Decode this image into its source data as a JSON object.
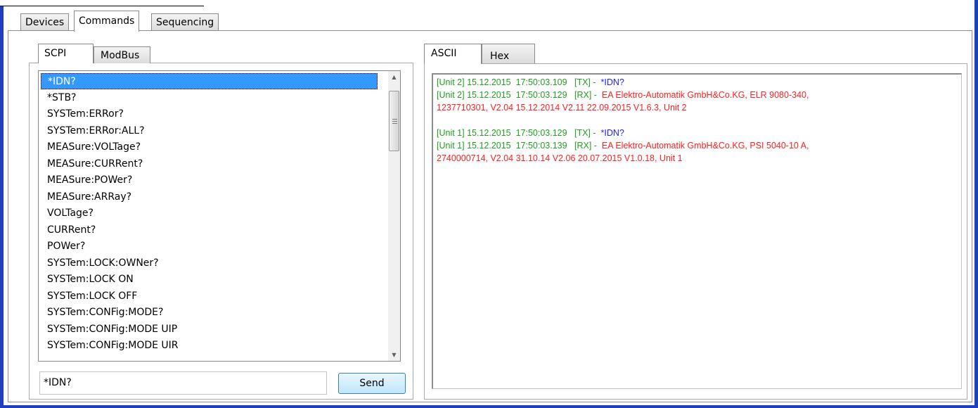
{
  "main_tabs": [
    "Devices",
    "Commands",
    "Sequencing"
  ],
  "protocol_tabs": [
    "SCPI",
    "ModBus"
  ],
  "view_tabs": [
    "ASCII",
    "Hex"
  ],
  "commands": [
    "*IDN?",
    "*STB?",
    "SYSTem:ERRor?",
    "SYSTem:ERRor:ALL?",
    "MEASure:VOLTage?",
    "MEASure:CURRent?",
    "MEASure:POWer?",
    "MEASure:ARRay?",
    "VOLTage?",
    "CURRent?",
    "POWer?",
    "SYSTem:LOCK:OWNer?",
    "SYSTem:LOCK ON",
    "SYSTem:LOCK OFF",
    "SYSTem:CONFig:MODE?",
    "SYSTem:CONFig:MODE UIP",
    "SYSTem:CONFig:MODE UIR"
  ],
  "command_input": "*IDN?",
  "send_label": "Send",
  "log": {
    "l1_prefix": "[Unit 2] 15.12.2015  17:50:03.109   [TX] - ",
    "l1_msg": " *IDN?",
    "l2_prefix": "[Unit 2] 15.12.2015  17:50:03.129   [RX] - ",
    "l2_msg": " EA Elektro-Automatik GmbH&Co.KG, ELR 9080-340,",
    "l3": "1237710301, V2.04 15.12.2014 V2.11 22.09.2015 V1.6.3, Unit 2",
    "l4_prefix": "[Unit 1] 15.12.2015  17:50:03.129   [TX] - ",
    "l4_msg": " *IDN?",
    "l5_prefix": "[Unit 1] 15.12.2015  17:50:03.139   [RX] - ",
    "l5_msg": " EA Elektro-Automatik GmbH&Co.KG, PSI 5040-10 A,",
    "l6": "2740000714, V2.04 31.10.14 V2.06 20.07.2015 V1.0.18, Unit 1"
  },
  "colors": {
    "selection": "#3399ff",
    "window_border": "#1f3fbf",
    "tx_rx_prefix": "#22a022",
    "tx_message": "#2020ff",
    "rx_message": "#ff2020"
  }
}
